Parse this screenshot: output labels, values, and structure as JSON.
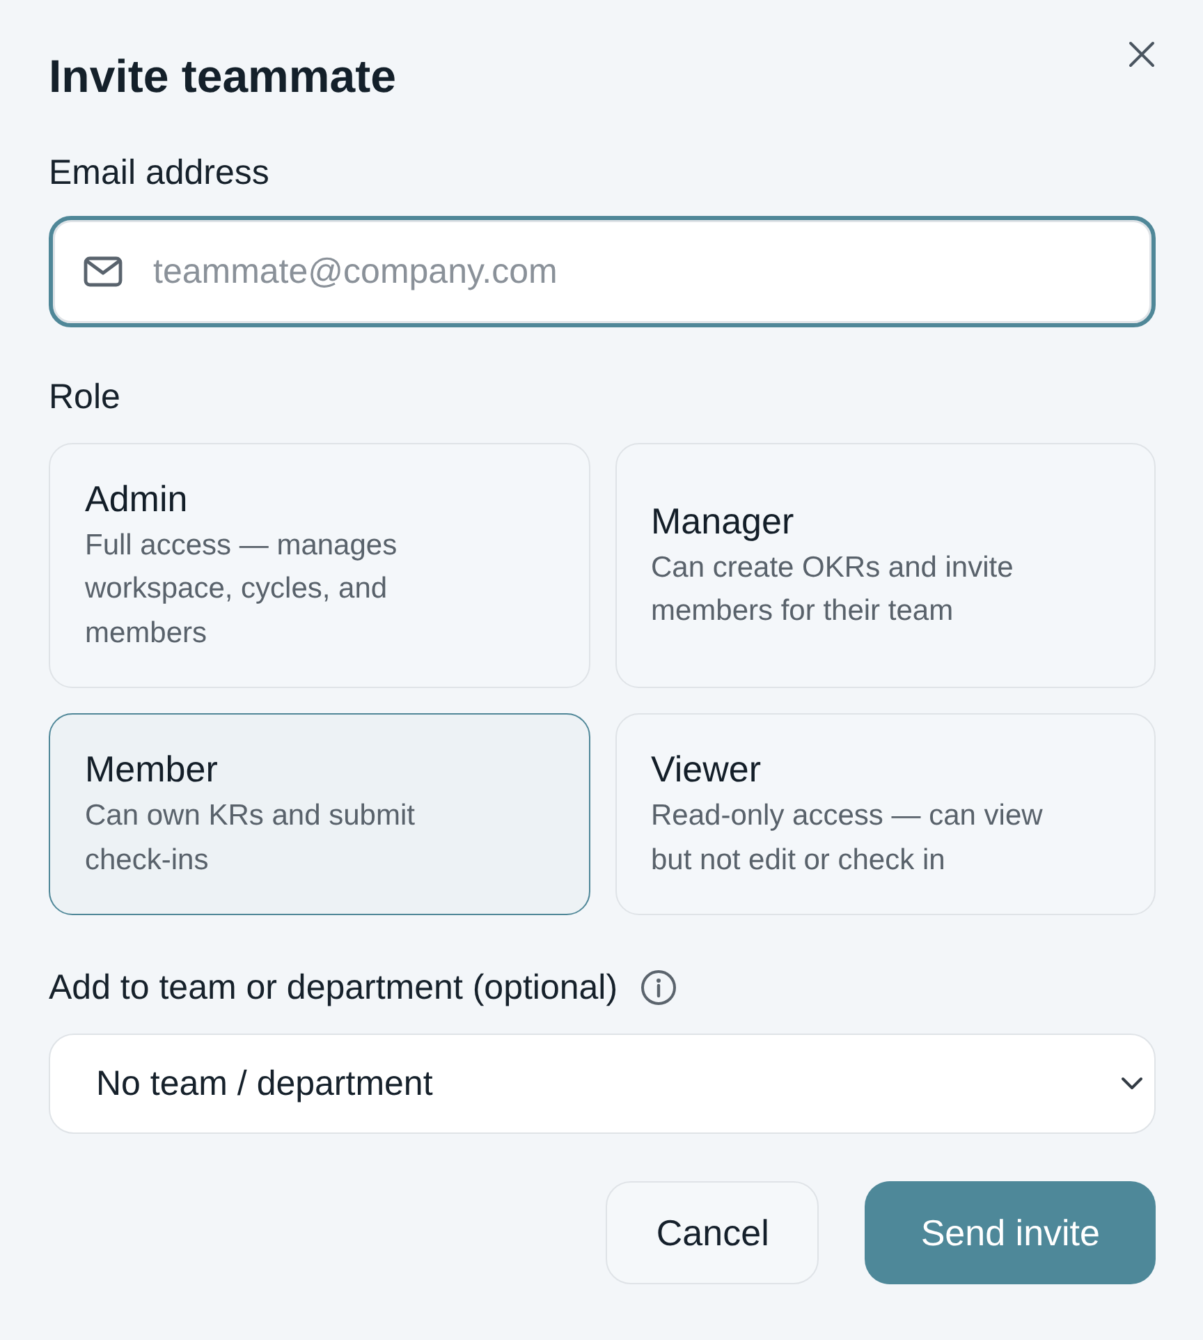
{
  "dialog": {
    "title": "Invite teammate"
  },
  "email": {
    "label": "Email address",
    "placeholder": "teammate@company.com",
    "focused": true
  },
  "role": {
    "label": "Role",
    "options": [
      {
        "name": "Admin",
        "description": "Full access — manages workspace, cycles, and members",
        "selected": false
      },
      {
        "name": "Manager",
        "description": "Can create OKRs and invite members for their team",
        "selected": false
      },
      {
        "name": "Member",
        "description": "Can own KRs and submit check-ins",
        "selected": true
      },
      {
        "name": "Viewer",
        "description": "Read-only access — can view but not edit or check in",
        "selected": false
      }
    ]
  },
  "team": {
    "label": "Add to team or department (optional)",
    "value": "No team / department"
  },
  "buttons": [
    {
      "label": "Cancel",
      "kind": "secondary"
    },
    {
      "label": "Send invite",
      "kind": "primary"
    }
  ]
}
